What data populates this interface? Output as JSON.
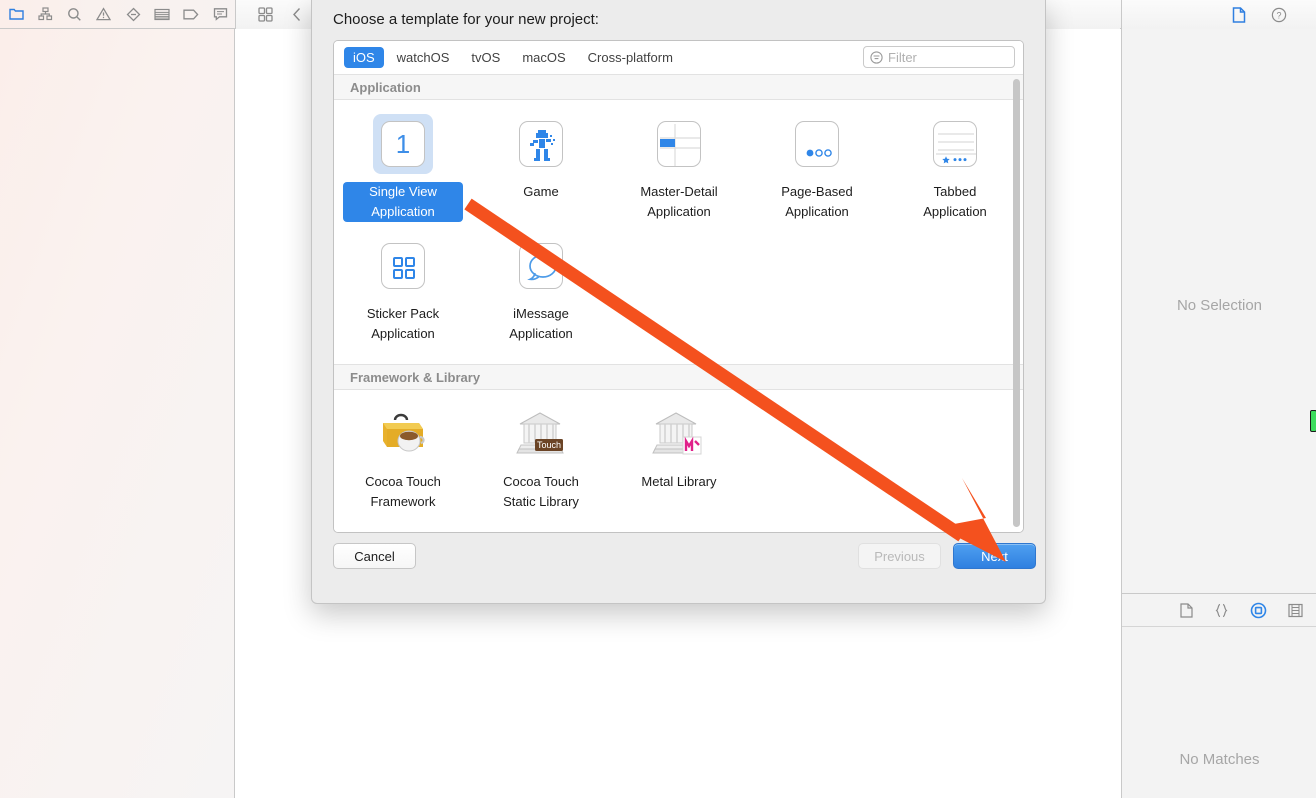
{
  "window": {
    "navigator_toolbar_icons": [
      "folder-icon",
      "hierarchy-icon",
      "search-icon",
      "warning-triangle-icon",
      "diamond-minus-icon",
      "test-list-icon",
      "tag-icon",
      "comment-icon"
    ],
    "editor_toolbar_icons": [
      "grid-icon",
      "chevron-left-icon",
      "chevron-right-icon"
    ],
    "inspector_toolbar_icons": [
      "file-inspector-icon",
      "quick-help-icon"
    ],
    "inspector": {
      "no_selection": "No Selection",
      "library_icons": [
        "file-template-icon",
        "code-snippet-icon",
        "object-library-icon",
        "media-library-icon"
      ],
      "no_matches": "No Matches"
    }
  },
  "dialog": {
    "title": "Choose a template for your new project:",
    "tabs": [
      {
        "label": "iOS",
        "active": true
      },
      {
        "label": "watchOS",
        "active": false
      },
      {
        "label": "tvOS",
        "active": false
      },
      {
        "label": "macOS",
        "active": false
      },
      {
        "label": "Cross-platform",
        "active": false
      }
    ],
    "filter": {
      "value": "",
      "placeholder": "Filter",
      "icon": "filter-icon"
    },
    "groups": [
      {
        "title": "Application",
        "templates": [
          {
            "label": "Single View Application",
            "icon": "single-view-icon",
            "selected": true
          },
          {
            "label": "Game",
            "icon": "game-robot-icon",
            "selected": false
          },
          {
            "label": "Master-Detail Application",
            "icon": "master-detail-icon",
            "selected": false
          },
          {
            "label": "Page-Based Application",
            "icon": "page-based-icon",
            "selected": false
          },
          {
            "label": "Tabbed Application",
            "icon": "tabbed-icon",
            "selected": false
          },
          {
            "label": "Sticker Pack Application",
            "icon": "sticker-pack-icon",
            "selected": false
          },
          {
            "label": "iMessage Application",
            "icon": "imessage-bubble-icon",
            "selected": false
          }
        ]
      },
      {
        "title": "Framework & Library",
        "templates": [
          {
            "label": "Cocoa Touch Framework",
            "icon": "toolbox-coffee-icon",
            "selected": false
          },
          {
            "label": "Cocoa Touch Static Library",
            "icon": "library-touch-icon",
            "selected": false
          },
          {
            "label": "Metal Library",
            "icon": "library-metal-icon",
            "selected": false
          }
        ]
      }
    ],
    "buttons": {
      "cancel": "Cancel",
      "previous": "Previous",
      "next": "Next"
    }
  },
  "annotation": {
    "arrow_color": "#F4511E",
    "arrow_points_to": "Next"
  }
}
